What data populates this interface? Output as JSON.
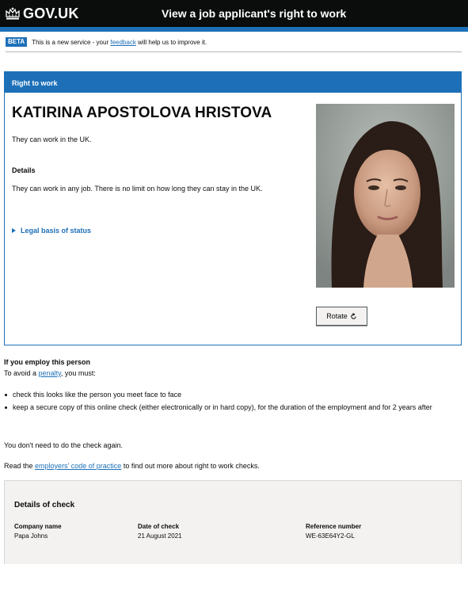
{
  "header": {
    "logo_text": "GOV.UK",
    "service_name": "View a job applicant's right to work"
  },
  "beta": {
    "tag": "BETA",
    "text_before": "This is a new service - your",
    "link": "feedback",
    "text_after": "will help us to improve it."
  },
  "card": {
    "heading": "Right to work",
    "name": "KATIRINA APOSTOLOVA HRISTOVA",
    "status": "They can work in the UK.",
    "details_heading": "Details",
    "details_text": "They can work in any job. There is no limit on how long they can stay in the UK.",
    "legal_link": "Legal basis of status",
    "rotate_label": "Rotate",
    "rotate_icon": "rotate-icon"
  },
  "employ": {
    "heading": "If you employ this person",
    "intro_before": "To avoid a",
    "intro_link": "penalty",
    "intro_after": ", you must:",
    "bullets": [
      "check this looks like the person you meet face to face",
      "keep a secure copy of this online check (either electronically or in hard copy), for the duration of the employment and for 2 years after"
    ],
    "no_again": "You don't need to do the check again.",
    "read_before": "Read the",
    "read_link": "employers' code of practice",
    "read_after": "to find out more about right to work checks."
  },
  "check": {
    "heading": "Details of check",
    "company_label": "Company name",
    "company_value": "Papa Johns",
    "date_label": "Date of check",
    "date_value": "21 August 2021",
    "ref_label": "Reference number",
    "ref_value": "WE-63E64Y2-GL"
  },
  "colors": {
    "brand_blue": "#1d70b8",
    "header_black": "#0b0c0c",
    "panel_grey": "#f3f2f1"
  }
}
